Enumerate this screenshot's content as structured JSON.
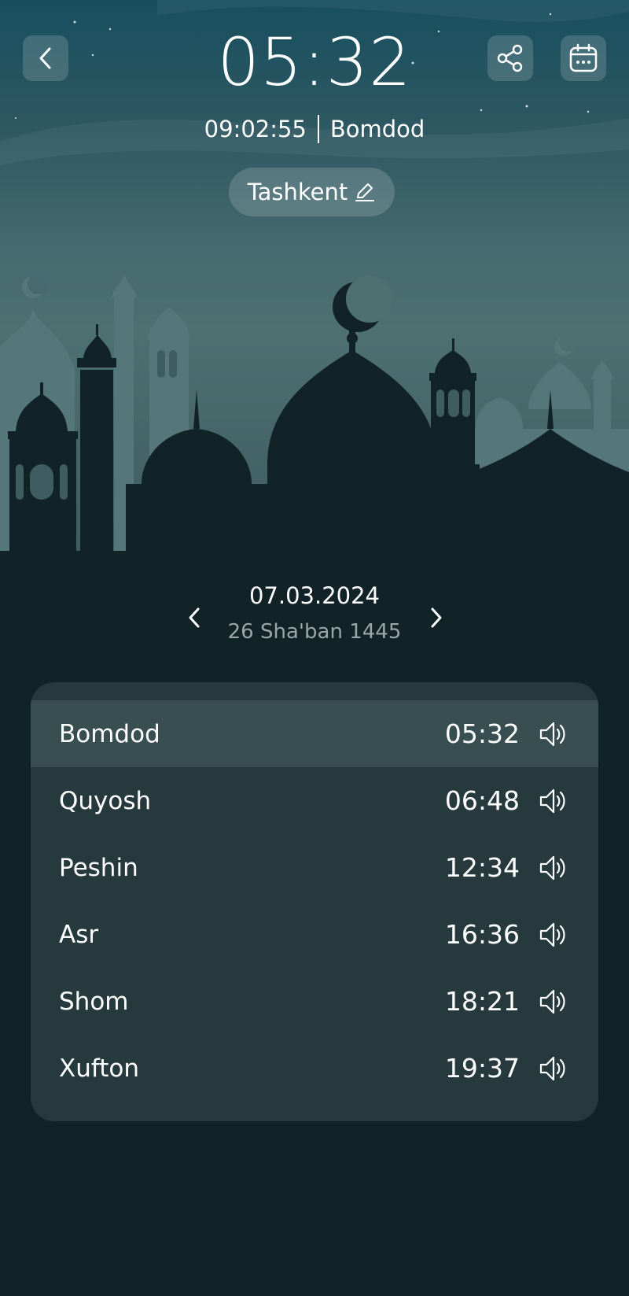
{
  "header": {
    "clock": "05:32",
    "countdown": "09:02:55",
    "next_prayer": "Bomdod",
    "city": "Tashkent"
  },
  "icons": {
    "back": "chevron-left-icon",
    "share": "share-icon",
    "calendar": "calendar-icon",
    "edit": "pencil-icon",
    "speaker": "speaker-icon"
  },
  "date": {
    "gregorian": "07.03.2024",
    "hijri": "26 Sha'ban 1445"
  },
  "prayers": [
    {
      "name": "Bomdod",
      "time": "05:32",
      "active": true
    },
    {
      "name": "Quyosh",
      "time": "06:48",
      "active": false
    },
    {
      "name": "Peshin",
      "time": "12:34",
      "active": false
    },
    {
      "name": "Asr",
      "time": "16:36",
      "active": false
    },
    {
      "name": "Shom",
      "time": "18:21",
      "active": false
    },
    {
      "name": "Xufton",
      "time": "19:37",
      "active": false
    }
  ],
  "colors": {
    "background": "#112327",
    "card": "#263a3e",
    "active_row": "#384e50",
    "hijri_text": "#9aa6a8"
  }
}
